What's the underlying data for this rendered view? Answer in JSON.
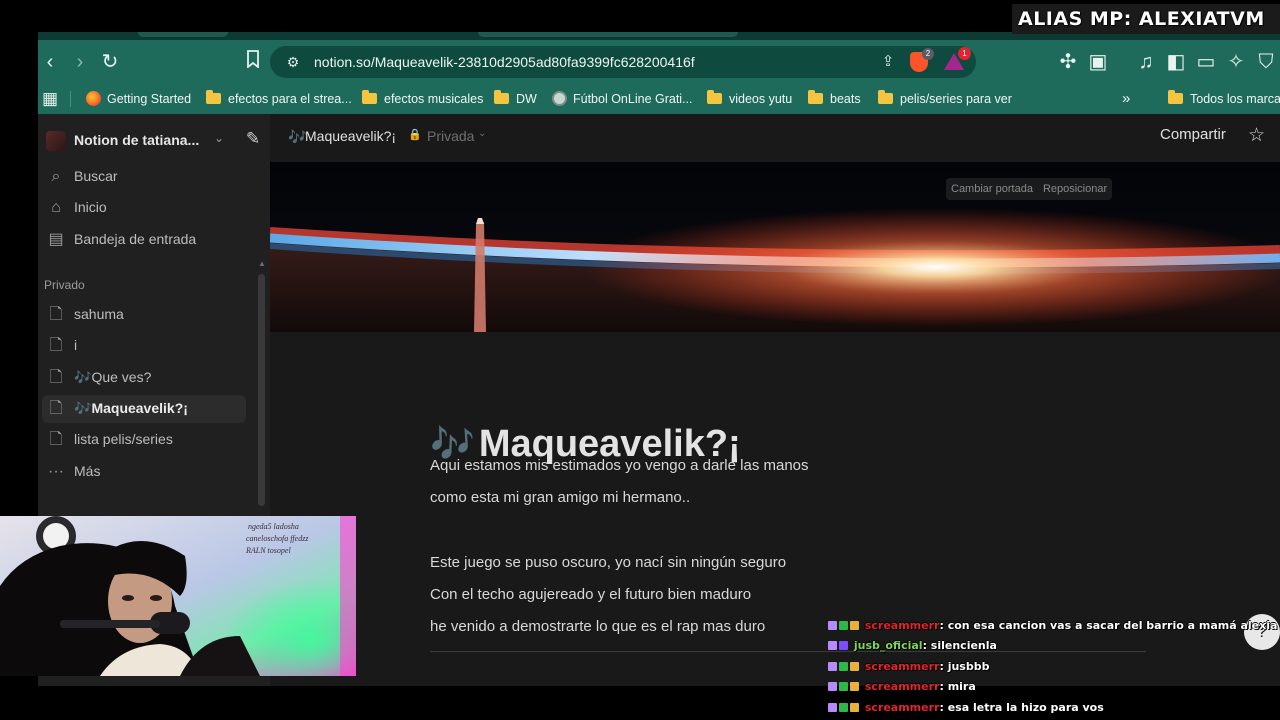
{
  "overlay": {
    "alias_text": "ALIAS MP: ALEXIATVM"
  },
  "browser": {
    "url": "notion.so/Maqueavelik-23810d2905ad80fa9399fc628200416f",
    "brave_shields_count": "2",
    "rewards_count": "1",
    "bookmarks": [
      {
        "label": "Getting Started",
        "type": "firefox"
      },
      {
        "label": "efectos para el strea...",
        "type": "folder"
      },
      {
        "label": "efectos musicales",
        "type": "folder"
      },
      {
        "label": "DW",
        "type": "folder"
      },
      {
        "label": "Fútbol OnLine Grati...",
        "type": "globe"
      },
      {
        "label": "videos yutu",
        "type": "folder"
      },
      {
        "label": "beats",
        "type": "folder"
      },
      {
        "label": "pelis/series para ver",
        "type": "folder"
      },
      {
        "label": "Todos los marcadores",
        "type": "folder"
      }
    ],
    "bookmarks_overflow": "»"
  },
  "notion": {
    "workspace_name": "Notion de tatiana...",
    "nav": {
      "search": "Buscar",
      "home": "Inicio",
      "inbox": "Bandeja de entrada"
    },
    "private_section_label": "Privado",
    "pages": [
      {
        "label": "sahuma",
        "emoji": ""
      },
      {
        "label": "i",
        "emoji": ""
      },
      {
        "label": "Que ves?",
        "emoji": "🎶"
      },
      {
        "label": "Maqueavelik?¡",
        "emoji": "🎶",
        "active": true
      },
      {
        "label": "lista pelis/series",
        "emoji": ""
      }
    ],
    "more_label": "Más",
    "breadcrumb": "Maqueavelik?¡",
    "privacy_label": "Privada",
    "share_label": "Compartir",
    "cover_actions": {
      "change": "Cambiar portada",
      "reposition": "Reposicionar"
    },
    "page": {
      "icon": "🎶",
      "title": "Maqueavelik?¡",
      "paragraphs": [
        "Aqui estamos mis estimados yo vengo a darle las manos",
        "como esta mi gran amigo mi hermano..",
        "",
        "Este juego se puso oscuro, yo nací sin ningún seguro",
        "Con el techo agujereado y el futuro bien maduro",
        "he venido a demostrarte lo que es el rap mas duro"
      ]
    }
  },
  "chat": [
    {
      "user": "screammerr",
      "user_color": "#e3242b",
      "message": ": con esa cancion vas a sacar del barrio a mamá alexia"
    },
    {
      "user": "jusb_oficial",
      "user_color": "#7fd65a",
      "message": ": silencienla"
    },
    {
      "user": "screammerr",
      "user_color": "#e3242b",
      "message": ": jusbbb"
    },
    {
      "user": "screammerr",
      "user_color": "#e3242b",
      "message": ": mira"
    },
    {
      "user": "screammerr",
      "user_color": "#e3242b",
      "message": ": esa letra la hizo para vos"
    }
  ],
  "colors": {
    "browser_toolbar": "#1e6b5b",
    "notion_bg": "#191919",
    "notion_sidebar": "#202020",
    "accent_music_icon": "#6fb6e8"
  }
}
